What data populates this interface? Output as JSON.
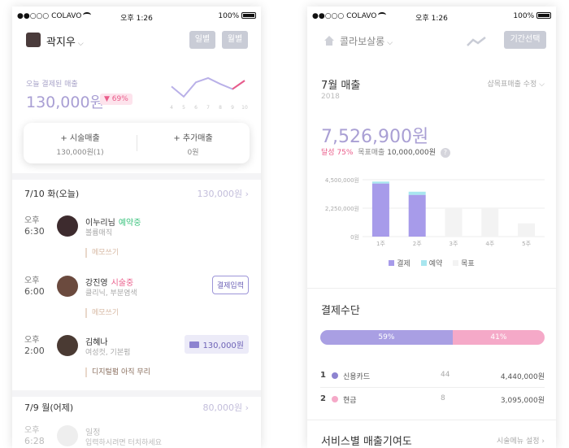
{
  "status_bar": {
    "carrier": "●●○○○ COLAVO",
    "time": "오후 1:26",
    "battery": "100%"
  },
  "left": {
    "store_name": "곽지우",
    "toggle_daily": "일별",
    "toggle_monthly": "월별",
    "today_label": "오늘 결제된 매출",
    "today_amount": "130,000원",
    "today_change": "▼ 69%",
    "sparkline": {
      "x_labels": [
        "4",
        "5",
        "6",
        "7",
        "8",
        "9",
        "10"
      ],
      "values": [
        1.5,
        0.3,
        2.0,
        2.5,
        1.8,
        1.2,
        2.2
      ]
    },
    "summary": {
      "service_label": "+ 시술매출",
      "service_value": "130,000원(1)",
      "extra_label": "+ 추가매출",
      "extra_value": "0원"
    },
    "days": [
      {
        "title": "7/10 화(오늘)",
        "total": "130,000원"
      },
      {
        "title": "7/9 월(어제)",
        "total": "80,000원"
      }
    ],
    "appointments": [
      {
        "ampm": "오후",
        "time": "6:30",
        "name": "이누리님",
        "status": "예약중",
        "status_color": "#3cc37e",
        "service": "볼륨매직",
        "memo": "메모쓰기",
        "action": ""
      },
      {
        "ampm": "오후",
        "time": "6:00",
        "name": "강진영",
        "status": "시술중",
        "status_color": "#ea5c8a",
        "service": "클리닉, 부분염색",
        "memo": "메모쓰기",
        "action": "결제입력"
      },
      {
        "ampm": "오후",
        "time": "2:00",
        "name": "김혜나",
        "status": "",
        "status_color": "#333333",
        "service": "여성컷, 기본펌",
        "memo": "디지털펌 아직 무리",
        "action": "130,000원"
      },
      {
        "ampm": "오후",
        "time": "6:28",
        "name": "일정",
        "status": "",
        "status_color": "#333333",
        "service": "입력하시려면 터치하세요",
        "memo": "",
        "action": ""
      }
    ]
  },
  "right": {
    "store_name": "콜라보살롱",
    "period_button": "기간선택",
    "month_title": "7월 매출",
    "year": "2018",
    "goal_edit": "샵목표매출 수정",
    "month_amount": "7,526,900원",
    "achievement_label": "달성",
    "achievement_pct": "75%",
    "goal_label": "목표매출",
    "goal_value": "10,000,000원",
    "help": "?",
    "legend": [
      "결제",
      "예약",
      "목표"
    ],
    "payment_title": "결제수단",
    "split": {
      "card_pct_label": "59%",
      "cash_pct_label": "41%",
      "card_fraction": 0.59
    },
    "payment_methods": [
      {
        "rank": "1",
        "name": "신용카드",
        "count": "44",
        "amount": "4,440,000원",
        "color": "#8d83d0"
      },
      {
        "rank": "2",
        "name": "현금",
        "count": "8",
        "amount": "3,095,000원",
        "color": "#f5a9c8"
      }
    ],
    "service_title": "서비스별 매출기여도",
    "service_setting": "시술메뉴 설정"
  },
  "chart_data": {
    "type": "bar",
    "categories": [
      "1주",
      "2주",
      "3주",
      "4주",
      "5주"
    ],
    "series": [
      {
        "name": "결제",
        "values": [
          4200000,
          3300000,
          0,
          0,
          0
        ]
      },
      {
        "name": "예약",
        "values": [
          150000,
          250000,
          0,
          0,
          0
        ]
      },
      {
        "name": "목표",
        "values": [
          0,
          0,
          2300000,
          2300000,
          1050000
        ]
      }
    ],
    "y_tick_labels": [
      "4,500,000원",
      "2,250,000원",
      "0원"
    ],
    "ylim": [
      0,
      4500000
    ],
    "colors": {
      "결제": "#a79bea",
      "예약": "#a8e6ef",
      "목표": "#f3f3f3"
    },
    "stacked": true,
    "grid": true,
    "legend_position": "bottom"
  }
}
